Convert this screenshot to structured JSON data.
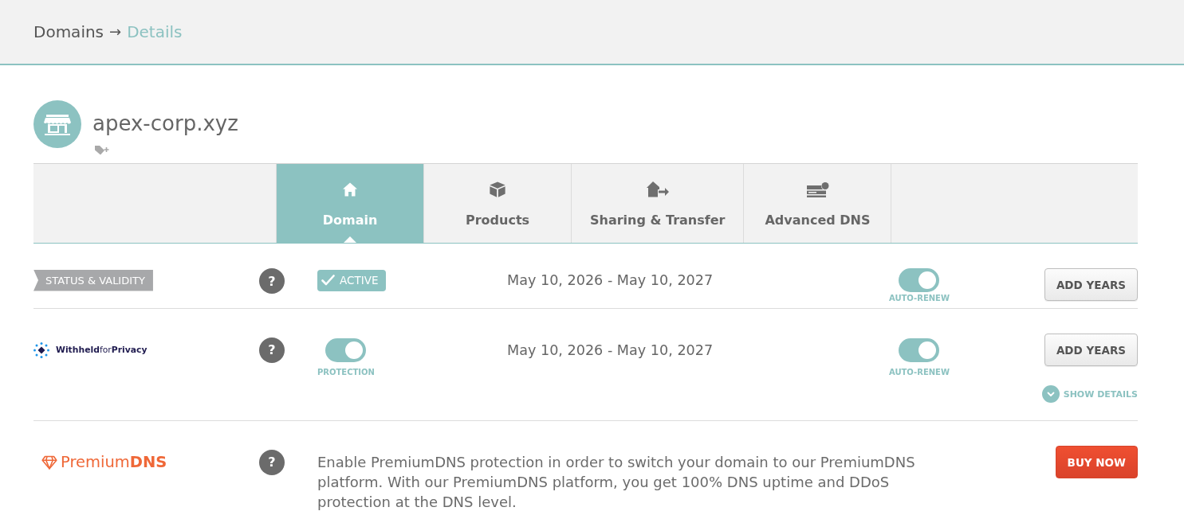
{
  "breadcrumb": {
    "separator": "→",
    "items": [
      {
        "label": "Domains",
        "selected": false
      },
      {
        "label": "Details",
        "selected": true
      }
    ]
  },
  "domain": {
    "name": "apex-corp.xyz"
  },
  "tabs": [
    {
      "label": "Domain",
      "selected": true
    },
    {
      "label": "Products",
      "selected": false
    },
    {
      "label": "Sharing & Transfer",
      "selected": false
    },
    {
      "label": "Advanced DNS",
      "selected": false
    }
  ],
  "rows": [
    {
      "kind": "status",
      "label": "STATUS & VALIDITY",
      "help": "?",
      "badge": "ACTIVE",
      "dates": "May 10, 2026 - May 10, 2027",
      "auto_renew": {
        "label": "AUTO-RENEW",
        "on": true
      },
      "button": {
        "kind": "secondary",
        "label": "ADD YEARS"
      }
    },
    {
      "kind": "privacy",
      "logo": "**Withheld**for**Privacy**",
      "help": "?",
      "protection": {
        "label": "PROTECTION",
        "on": true
      },
      "dates": "May 10, 2026 - May 10, 2027",
      "auto_renew": {
        "label": "AUTO-RENEW",
        "on": true
      },
      "button": {
        "kind": "secondary",
        "label": "ADD YEARS"
      },
      "details_link": "SHOW DETAILS"
    },
    {
      "kind": "premium",
      "logo": "Premium**DNS**",
      "help": "?",
      "description": "Enable PremiumDNS protection in order to switch your domain to our PremiumDNS platform. With our PremiumDNS platform, you get 100% DNS uptime and DDoS protection at the DNS level.",
      "button": {
        "kind": "primary",
        "label": "BUY NOW"
      }
    }
  ]
}
